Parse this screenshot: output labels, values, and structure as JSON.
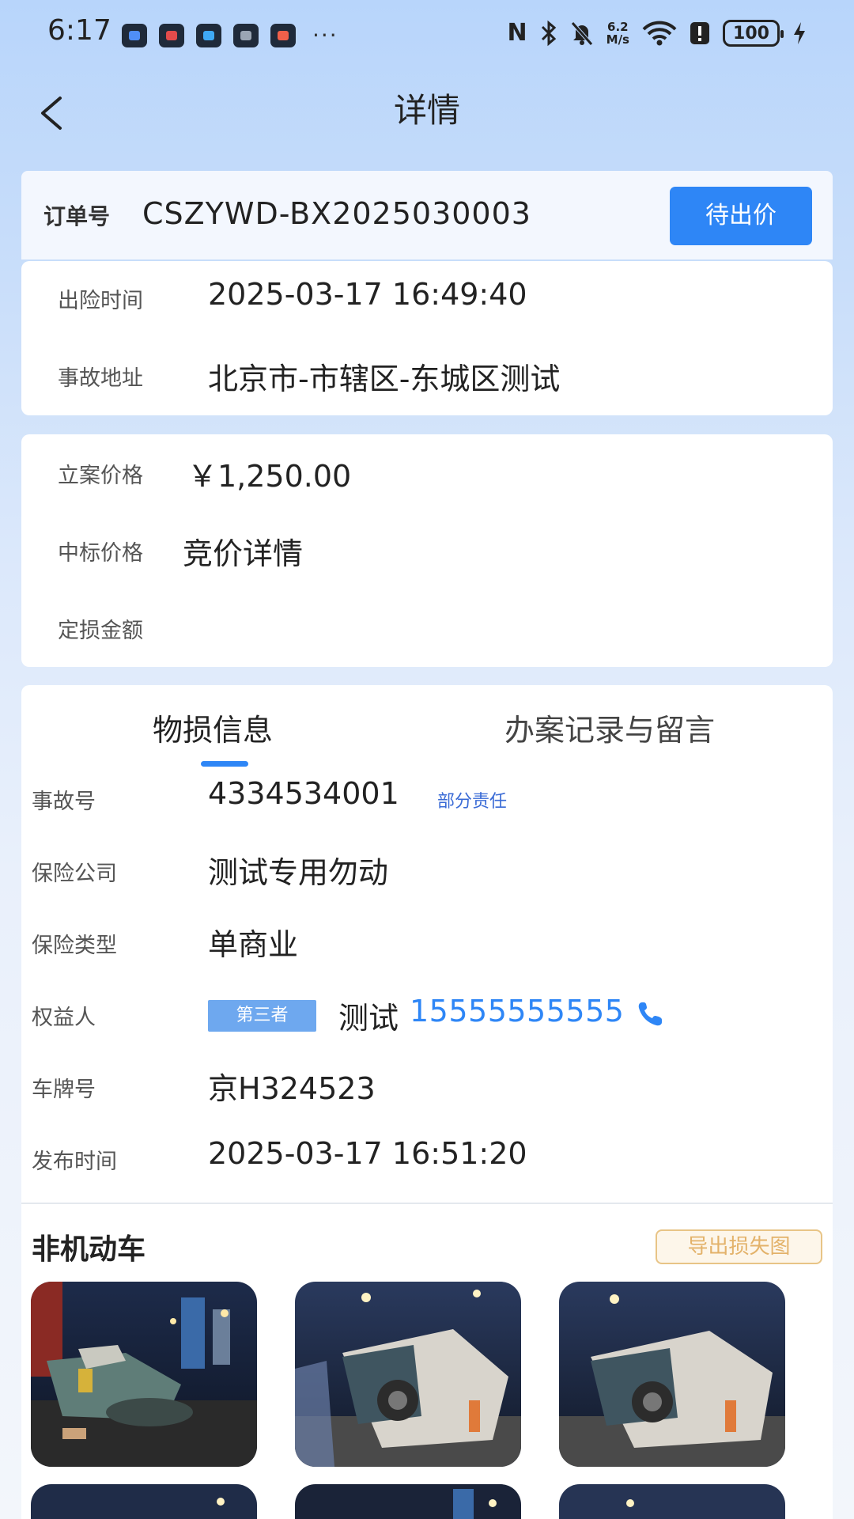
{
  "status_bar": {
    "time": "6:17",
    "more": "···",
    "net_speed_value": "6.2",
    "net_speed_unit": "M/s",
    "battery": "100"
  },
  "header": {
    "title": "详情",
    "back_icon": "chevron-left-icon"
  },
  "order": {
    "label": "订单号",
    "number": "CSZYWD-BX2025030003",
    "status_button": "待出价"
  },
  "incident": {
    "time_label": "出险时间",
    "time_value": "2025-03-17 16:49:40",
    "address_label": "事故地址",
    "address_value": "北京市-市辖区-东城区测试"
  },
  "pricing": {
    "case_price_label": "立案价格",
    "case_price_value": "￥1,250.00",
    "winning_price_label": "中标价格",
    "winning_price_value": "竞价详情",
    "loss_amount_label": "定损金额",
    "loss_amount_value": ""
  },
  "tabs": [
    {
      "label": "物损信息",
      "active": true
    },
    {
      "label": "办案记录与留言",
      "active": false
    }
  ],
  "details": {
    "accident_no_label": "事故号",
    "accident_no": "4334534001",
    "responsibility": "部分责任",
    "insurer_label": "保险公司",
    "insurer": "测试专用勿动",
    "insurance_type_label": "保险类型",
    "insurance_type": "单商业",
    "beneficiary_label": "权益人",
    "beneficiary_badge": "第三者",
    "beneficiary_name": "测试",
    "beneficiary_phone": "15555555555",
    "plate_label": "车牌号",
    "plate": "京H324523",
    "publish_time_label": "发布时间",
    "publish_time": "2025-03-17 16:51:20"
  },
  "section": {
    "title": "非机动车",
    "export_button": "导出损失图"
  },
  "photos": [
    "accident-photo-1",
    "accident-photo-2",
    "accident-photo-3",
    "accident-photo-4",
    "accident-photo-5",
    "accident-photo-6"
  ],
  "colors": {
    "accent": "#2e86f6",
    "header_bg": "#b8d5fb",
    "export_border": "#e8c486",
    "badge": "#6ea8ef"
  }
}
